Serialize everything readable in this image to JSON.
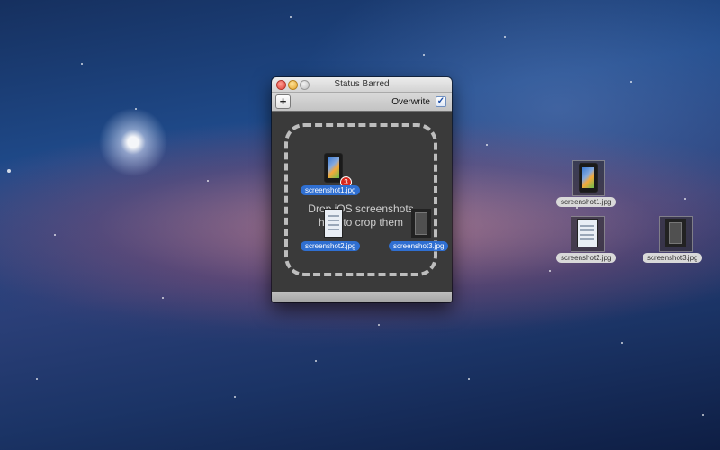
{
  "window": {
    "title": "Status Barred",
    "add_button_label": "+",
    "overwrite_label": "Overwrite",
    "overwrite_checked": true,
    "drop_text_line1": "Drop iOS screenshots",
    "drop_text_line2": "here to crop them",
    "badge_count": "3"
  },
  "dragged_files": [
    {
      "name": "screenshot1.jpg",
      "icon": "phone-screenshot-icon"
    },
    {
      "name": "screenshot2.jpg",
      "icon": "document-screenshot-icon"
    },
    {
      "name": "screenshot3.jpg",
      "icon": "dark-screenshot-icon"
    }
  ],
  "desktop_files": [
    {
      "name": "screenshot1.jpg",
      "icon": "phone-screenshot-icon"
    },
    {
      "name": "screenshot2.jpg",
      "icon": "document-screenshot-icon"
    },
    {
      "name": "screenshot3.jpg",
      "icon": "dark-screenshot-icon"
    }
  ],
  "colors": {
    "selection": "#2f6fd1",
    "badge": "#d8271c",
    "window_body": "#3a3a3a"
  }
}
